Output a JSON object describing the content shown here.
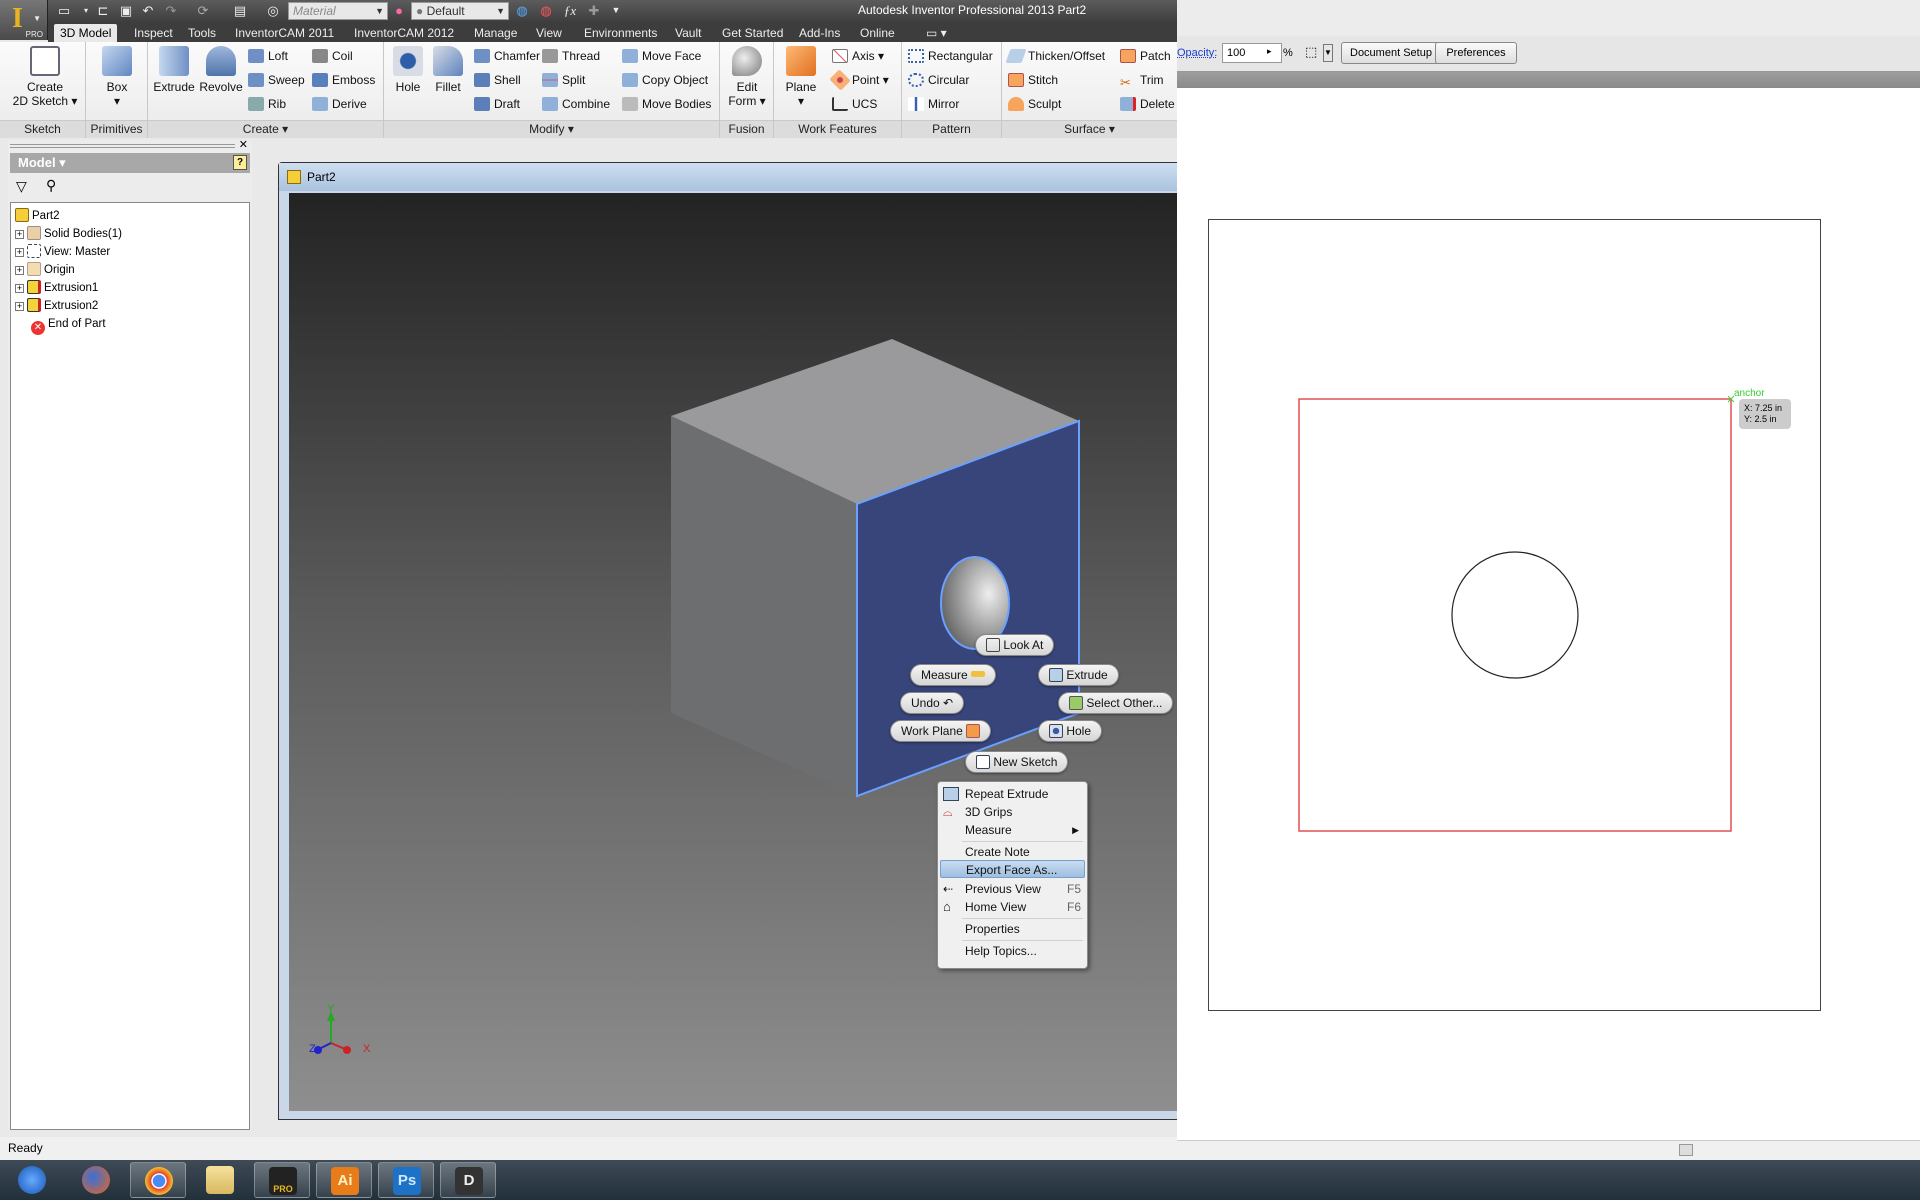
{
  "app": {
    "title": "Autodesk Inventor Professional 2013   Part2",
    "logo": "I",
    "logo_badge": "PRO"
  },
  "quick_access": {
    "material_placeholder": "Material",
    "appearance_value": "Default",
    "icons": [
      "new-icon",
      "open-icon",
      "save-icon",
      "undo-icon",
      "redo-icon",
      "update-icon",
      "select-icon",
      "appearance-icon",
      "color-override-icon",
      "clear-override-icon",
      "fx-parameters-icon",
      "cross-icon",
      "customize-icon"
    ]
  },
  "tabs": [
    {
      "label": "3D Model",
      "active": true
    },
    {
      "label": "Inspect"
    },
    {
      "label": "Tools"
    },
    {
      "label": "InventorCAM 2011"
    },
    {
      "label": "InventorCAM 2012"
    },
    {
      "label": "Manage"
    },
    {
      "label": "View"
    },
    {
      "label": "Environments"
    },
    {
      "label": "Vault"
    },
    {
      "label": "Get Started"
    },
    {
      "label": "Add-Ins"
    },
    {
      "label": "Online"
    }
  ],
  "ribbon": {
    "groups": {
      "sketch": {
        "label": "Sketch",
        "create_sketch": "Create 2D Sketch",
        "create_line1": "Create",
        "create_line2": "2D Sketch"
      },
      "primitives": {
        "label": "Primitives",
        "box": "Box"
      },
      "create": {
        "label": "Create",
        "extrude": "Extrude",
        "revolve": "Revolve",
        "loft": "Loft",
        "sweep": "Sweep",
        "rib": "Rib",
        "coil": "Coil",
        "emboss": "Emboss",
        "derive": "Derive"
      },
      "modify": {
        "label": "Modify",
        "hole": "Hole",
        "fillet": "Fillet",
        "chamfer": "Chamfer",
        "shell": "Shell",
        "draft": "Draft",
        "thread": "Thread",
        "split": "Split",
        "combine": "Combine",
        "move_face": "Move Face",
        "copy_object": "Copy Object",
        "move_bodies": "Move Bodies"
      },
      "fusion": {
        "label": "Fusion",
        "edit_form_line1": "Edit",
        "edit_form_line2": "Form"
      },
      "work_features": {
        "label": "Work Features",
        "plane": "Plane",
        "axis": "Axis",
        "point": "Point",
        "ucs": "UCS"
      },
      "pattern": {
        "label": "Pattern",
        "rectangular": "Rectangular",
        "circular": "Circular",
        "mirror": "Mirror"
      },
      "surface": {
        "label": "Surface",
        "thicken": "Thicken/Offset",
        "stitch": "Stitch",
        "sculpt": "Sculpt",
        "patch": "Patch",
        "trim": "Trim",
        "delete": "Delete"
      }
    }
  },
  "browser": {
    "title": "Model",
    "help": "?",
    "tree": [
      {
        "label": "Part2",
        "icon": "part-icon",
        "level": 0
      },
      {
        "label": "Solid Bodies(1)",
        "icon": "solid-bodies-icon",
        "level": 1,
        "expandable": true
      },
      {
        "label": "View: Master",
        "icon": "view-rep-icon",
        "level": 1,
        "expandable": true
      },
      {
        "label": "Origin",
        "icon": "folder-icon",
        "level": 1,
        "expandable": true
      },
      {
        "label": "Extrusion1",
        "icon": "extrusion-icon",
        "level": 1,
        "expandable": true
      },
      {
        "label": "Extrusion2",
        "icon": "extrusion-icon",
        "level": 1,
        "expandable": true
      },
      {
        "label": "End of Part",
        "icon": "end-of-part-icon",
        "level": 1
      }
    ]
  },
  "document": {
    "title": "Part2"
  },
  "marking_menu": {
    "look_at": "Look At",
    "measure": "Measure",
    "extrude": "Extrude",
    "undo": "Undo",
    "select_other": "Select Other...",
    "work_plane": "Work Plane",
    "hole": "Hole",
    "new_sketch": "New Sketch"
  },
  "context_menu": {
    "items": [
      {
        "label": "Repeat Extrude",
        "icon": "extrude-icon"
      },
      {
        "label": "3D Grips",
        "icon": "grips-icon"
      },
      {
        "label": "Measure",
        "submenu": true
      },
      {
        "label": "Create Note"
      },
      {
        "label": "Export Face As...",
        "highlighted": true
      },
      {
        "label": "Previous View",
        "shortcut": "F5",
        "icon": "previous-view-icon"
      },
      {
        "label": "Home View",
        "shortcut": "F6",
        "icon": "home-icon"
      },
      {
        "label": "Properties"
      },
      {
        "label": "Help Topics..."
      }
    ]
  },
  "triad": {
    "x": "X",
    "y": "Y",
    "z": "Z"
  },
  "status": {
    "text": "Ready"
  },
  "illustrator": {
    "opacity_label": "Opacity:",
    "opacity_value": "100",
    "opacity_unit": "%",
    "document_setup": "Document Setup",
    "preferences": "Preferences",
    "anchor_label": "anchor",
    "readout_x": "X: 7.25 in",
    "readout_y": "Y: 2.5 in",
    "square_stroke": "#e05050",
    "circle_stroke": "#222222"
  },
  "taskbar": {
    "items": [
      {
        "name": "start",
        "label": ""
      },
      {
        "name": "firefox",
        "label": ""
      },
      {
        "name": "chrome",
        "label": ""
      },
      {
        "name": "explorer",
        "label": ""
      },
      {
        "name": "inventor",
        "label": "PRO"
      },
      {
        "name": "illustrator",
        "label": "Ai"
      },
      {
        "name": "photoshop",
        "label": "Ps"
      },
      {
        "name": "dfx",
        "label": "D"
      }
    ]
  },
  "colors": {
    "selected_face": "#38457a",
    "highlight_edge": "#6aa0ff",
    "tab_bar": "#3d3d3d"
  }
}
